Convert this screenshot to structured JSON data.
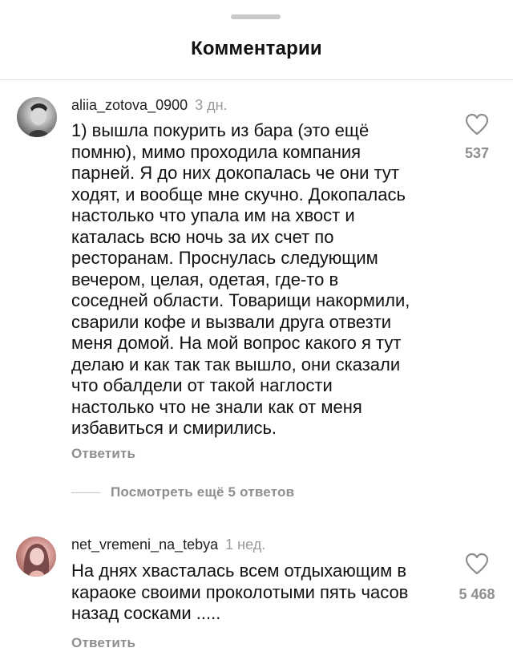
{
  "sheet": {
    "title": "Комментарии"
  },
  "comments": [
    {
      "username": "aliia_zotova_0900",
      "time": "3 дн.",
      "text": "1) вышла покурить из бара (это ещё\nпомню), мимо проходила компания\nпарней. Я до них докопалась че они тут\nходят, и вообще мне скучно. Докопалась\nнастолько что упала им на хвост и\nкаталась всю ночь за их счет по\nресторанам. Проснулась следующим\nвечером, целая, одетая, где-то в\nсоседней области. Товарищи накормили,\nсварили кофе и вызвали друга отвезти\nменя домой. На мой вопрос какого я тут\nделаю и как так так вышло, они сказали\nчто обалдели от такой наглости\nнастолько что не знали как от меня\nизбавиться и смирились.",
      "likes": "537",
      "reply_label": "Ответить",
      "view_replies_label": "Посмотреть ещё 5 ответов",
      "avatar": "avatar-user-photo",
      "like_icon": "heart-icon"
    },
    {
      "username": "net_vremeni_na_tebya",
      "time": "1 нед.",
      "text": "На днях хвасталась всем отдыхающим в\nкараоке своими проколотыми пять часов\nназад сосками .....",
      "likes": "5 468",
      "reply_label": "Ответить",
      "avatar": "avatar-user-photo",
      "like_icon": "heart-icon"
    }
  ],
  "colors": {
    "text": "#111111",
    "secondary": "#8e8e8e",
    "divider": "#e3e3e3",
    "grabber": "#c9c9c9"
  }
}
